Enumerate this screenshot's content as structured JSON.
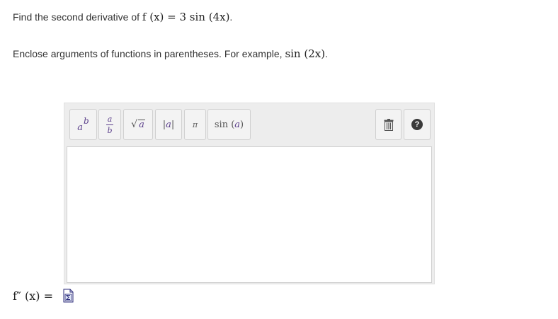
{
  "question": {
    "prefix": "Find the second derivative of ",
    "math": "f (x) = 3 sin (4x)",
    "suffix": "."
  },
  "instruction": {
    "prefix": "Enclose arguments of functions in parentheses. For example, ",
    "math": "sin (2x)",
    "suffix": "."
  },
  "toolbar": {
    "buttons": [
      {
        "name": "power-button",
        "base": "a",
        "sup": "b"
      },
      {
        "name": "fraction-button",
        "num": "a",
        "den": "b"
      },
      {
        "name": "sqrt-button",
        "root": "√",
        "radicand": "a"
      },
      {
        "name": "abs-button",
        "left": "|",
        "inner": "a",
        "right": "|"
      },
      {
        "name": "pi-button",
        "glyph": "π"
      },
      {
        "name": "sin-button",
        "fn": "sin",
        "open": "(",
        "arg": "a",
        "close": ")"
      },
      {
        "name": "trash-button",
        "icon": "trash-icon"
      },
      {
        "name": "help-button",
        "icon": "help-icon",
        "glyph": "?"
      }
    ]
  },
  "answer": {
    "label_math": "f″ (x) =",
    "icon": "formula-editor-icon"
  },
  "colors": {
    "toolbar_bg": "#ededed",
    "variable_purple": "#5a3e8a",
    "help_circle": "#3a3a3a",
    "text": "#333333"
  }
}
